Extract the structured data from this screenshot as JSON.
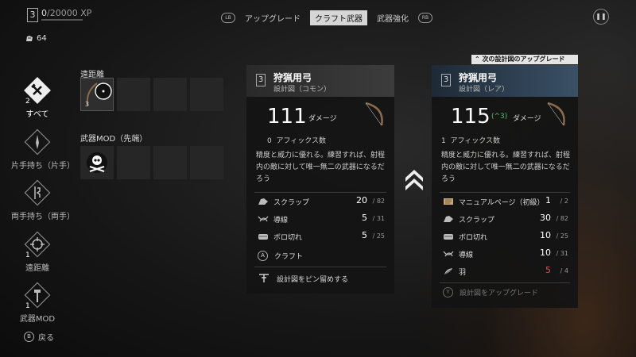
{
  "player": {
    "level": "3",
    "xp_current": "0",
    "xp_total": "/20000 XP",
    "xp_progress": 0.0,
    "scrap_count": "64"
  },
  "tabs": {
    "left_shoulder": "LB",
    "right_shoulder": "RB",
    "items": [
      "アップグレード",
      "クラフト武器",
      "武器強化"
    ],
    "active_index": 1
  },
  "pause_icon": "pause-icon",
  "categories": [
    {
      "count": "2",
      "label": "すべて",
      "icon": "crossed-tools-icon"
    },
    {
      "count": "",
      "label": "片手持ち（片手）",
      "icon": "dagger-icon"
    },
    {
      "count": "",
      "label": "両手持ち（両手）",
      "icon": "two-hand-icon"
    },
    {
      "count": "1",
      "label": "遠距離",
      "icon": "crosshair-icon"
    },
    {
      "count": "1",
      "label": "武器MOD",
      "icon": "hammer-icon"
    }
  ],
  "back": {
    "button": "B",
    "label": "戻る"
  },
  "grid": {
    "ranged_title": "遠距離",
    "ranged_selected_count": "3",
    "mod_title": "武器MOD（先端）",
    "mod_icon": "skull-crossbones-icon"
  },
  "current_card": {
    "level": "3",
    "name": "狩猟用弓",
    "rarity": "設計図（コモン）",
    "damage": "111",
    "damage_label": "ダメージ",
    "affix_count": "0",
    "affix_label": "アフィックス数",
    "description": "精度と威力に優れる。練習すれば、射程内の敵に対して唯一無二の武器になるだろう",
    "materials": [
      {
        "name": "スクラップ",
        "have": "20",
        "need": "/ 82",
        "icon": "scrap-icon"
      },
      {
        "name": "導線",
        "have": "5",
        "need": "/ 31",
        "icon": "wire-icon"
      },
      {
        "name": "ボロ切れ",
        "have": "5",
        "need": "/ 25",
        "icon": "rag-icon"
      }
    ],
    "craft_button": "A",
    "craft_label": "クラフト",
    "pin_label": "設計図をピン留めする"
  },
  "upgrade_arrow": "double-chevron-up-icon",
  "next_card": {
    "banner": "次の設計図のアップグレード",
    "level": "3",
    "name": "狩猟用弓",
    "rarity": "設計図（レア）",
    "damage": "115",
    "damage_bonus": "(^3)",
    "damage_label": "ダメージ",
    "affix_count": "1",
    "affix_label": "アフィックス数",
    "description": "精度と威力に優れる。練習すれば、射程内の敵に対して唯一無二の武器になるだろう",
    "materials": [
      {
        "name": "マニュアルページ（初級）",
        "have": "1",
        "need": "/ 2",
        "icon": "manual-page-icon",
        "insufficient": false
      },
      {
        "name": "スクラップ",
        "have": "30",
        "need": "/ 82",
        "icon": "scrap-icon",
        "insufficient": false
      },
      {
        "name": "ボロ切れ",
        "have": "10",
        "need": "/ 25",
        "icon": "rag-icon",
        "insufficient": false
      },
      {
        "name": "導線",
        "have": "10",
        "need": "/ 31",
        "icon": "wire-icon",
        "insufficient": false
      },
      {
        "name": "羽",
        "have": "5",
        "need": "/ 4",
        "icon": "feather-icon",
        "insufficient": true
      }
    ],
    "upgrade_button": "Y",
    "upgrade_label": "設計図をアップグレード"
  },
  "colors": {
    "accent_active_tab": "#d6d6d6",
    "insufficient": "#e05050",
    "card_bg": "#141414"
  }
}
